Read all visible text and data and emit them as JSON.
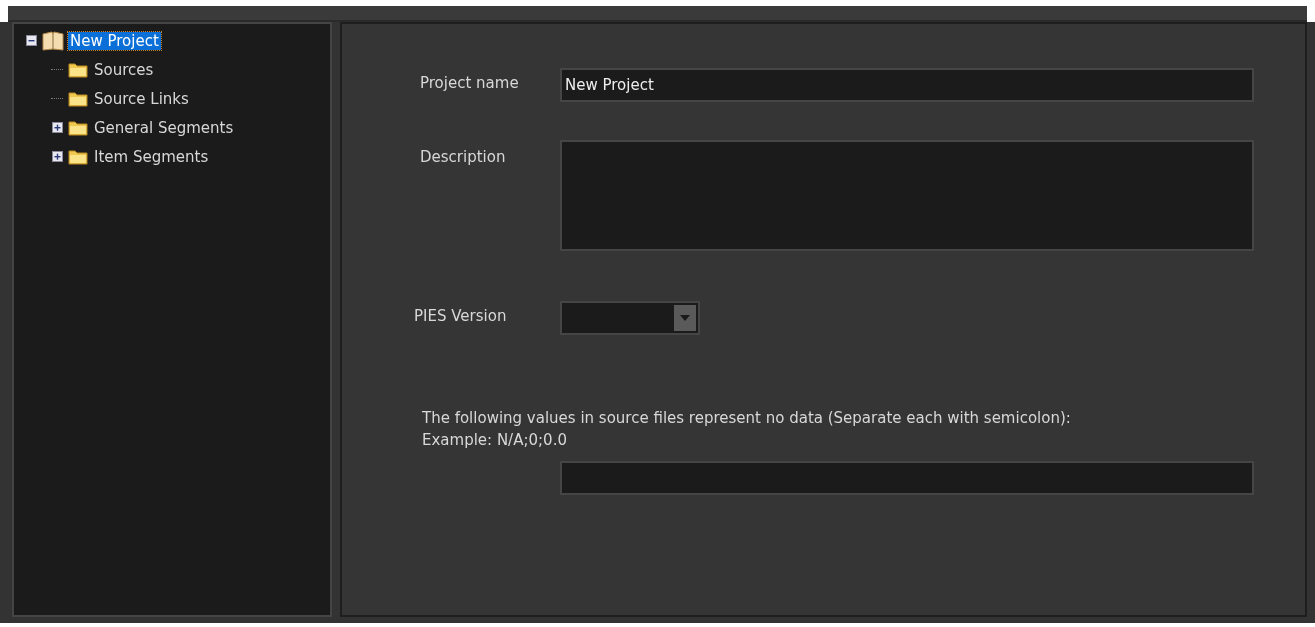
{
  "tree": [
    {
      "label": "New Project",
      "kind": "project",
      "expandable": true,
      "expanded": true,
      "selected": true,
      "children": [
        {
          "label": "Sources",
          "kind": "folder",
          "expandable": false,
          "selected": false
        },
        {
          "label": "Source Links",
          "kind": "folder",
          "expandable": false,
          "selected": false
        },
        {
          "label": "General Segments",
          "kind": "folder",
          "expandable": true,
          "expanded": false,
          "selected": false
        },
        {
          "label": "Item Segments",
          "kind": "folder",
          "expandable": true,
          "expanded": false,
          "selected": false
        }
      ]
    }
  ],
  "form": {
    "project_name": {
      "label": "Project name",
      "value": "New Project"
    },
    "description": {
      "label": "Description"
    },
    "pies_version": {
      "label": "PIES Version"
    },
    "no_data": {
      "instruction": "The following values in source files represent no data  (Separate each with semicolon):",
      "example": "Example: N/A;0;0.0"
    }
  }
}
